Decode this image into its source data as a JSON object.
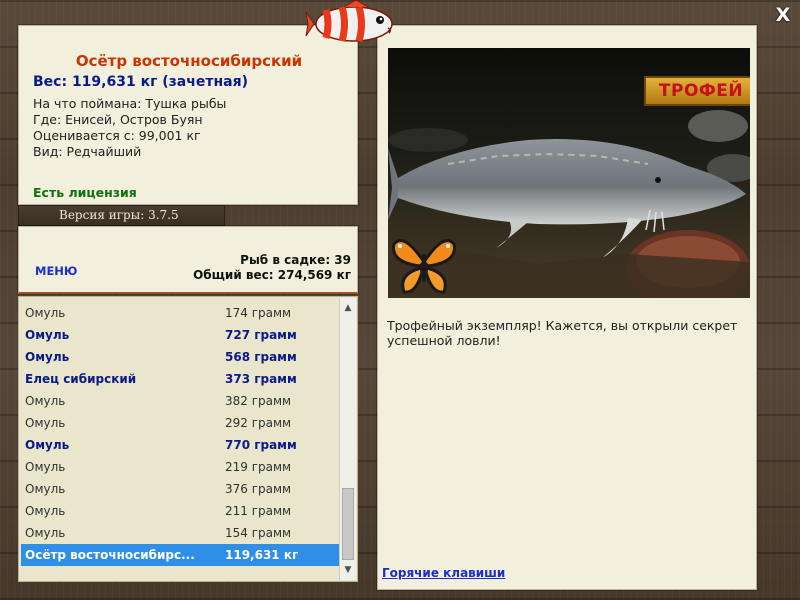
{
  "window": {
    "close_label": "X"
  },
  "catch_info": {
    "title": "Осётр восточносибирский",
    "weight_line": "Вес: 119,631 кг (зачетная)",
    "lines": [
      "На что поймана: Тушка рыбы",
      "Где: Енисей, Остров Буян",
      "Оценивается с: 99,001 кг",
      "Вид: Редчайший"
    ],
    "license": "Есть лицензия"
  },
  "version_label": "Версия игры: 3.7.5",
  "menu_label": "МЕНЮ",
  "keep_net": {
    "fish_count": "Рыб в садке: 39",
    "total_weight": "Общий вес: 274,569 кг"
  },
  "catch_list": [
    {
      "name": "Омуль",
      "weight": "174 грамм",
      "style": "normal"
    },
    {
      "name": "Омуль",
      "weight": "727 грамм",
      "style": "bold"
    },
    {
      "name": "Омуль",
      "weight": "568 грамм",
      "style": "bold"
    },
    {
      "name": "Елец сибирский",
      "weight": "373 грамм",
      "style": "bold"
    },
    {
      "name": "Омуль",
      "weight": "382 грамм",
      "style": "normal"
    },
    {
      "name": "Омуль",
      "weight": "292 грамм",
      "style": "normal"
    },
    {
      "name": "Омуль",
      "weight": "770 грамм",
      "style": "bold"
    },
    {
      "name": "Омуль",
      "weight": "219 грамм",
      "style": "normal"
    },
    {
      "name": "Омуль",
      "weight": "376 грамм",
      "style": "normal"
    },
    {
      "name": "Омуль",
      "weight": "211 грамм",
      "style": "normal"
    },
    {
      "name": "Омуль",
      "weight": "154 грамм",
      "style": "normal"
    },
    {
      "name": "Осётр восточносибирс...",
      "weight": "119,631 кг",
      "style": "selected"
    }
  ],
  "photo": {
    "badge": "ТРОФЕЙ",
    "caption": "Трофейный экземпляр! Кажется, вы открыли секрет успешной ловли!"
  },
  "hotkeys_label": "Горячие клавиши",
  "colors": {
    "title": "#cc3300",
    "weight": "#0a1a8a",
    "license": "#107010",
    "link": "#1a2ec8",
    "selection": "#2f8fe6",
    "panel": "#f2f0dc"
  },
  "icons": [
    "fish-logo-icon",
    "close-icon",
    "scroll-up-icon",
    "scroll-down-icon",
    "butterfly-icon"
  ]
}
